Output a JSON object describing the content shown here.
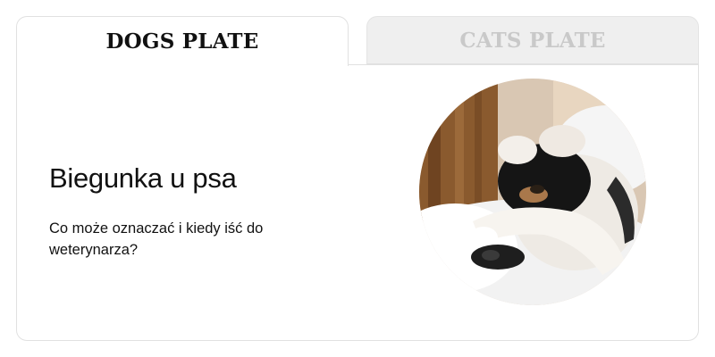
{
  "tabs": [
    {
      "label": "DOGS PLATE",
      "active": true
    },
    {
      "label": "CATS PLATE",
      "active": false
    }
  ],
  "article": {
    "title": "Biegunka u psa",
    "subtitle": "Co może oznaczać i kiedy iść do weterynarza?",
    "image_subject": "dog-sleeping-covering-face-with-paw"
  },
  "colors": {
    "active_tab_text": "#111111",
    "inactive_tab_text": "#c9c9c9",
    "inactive_tab_bg": "#efefef",
    "border": "#e1e1e1"
  }
}
